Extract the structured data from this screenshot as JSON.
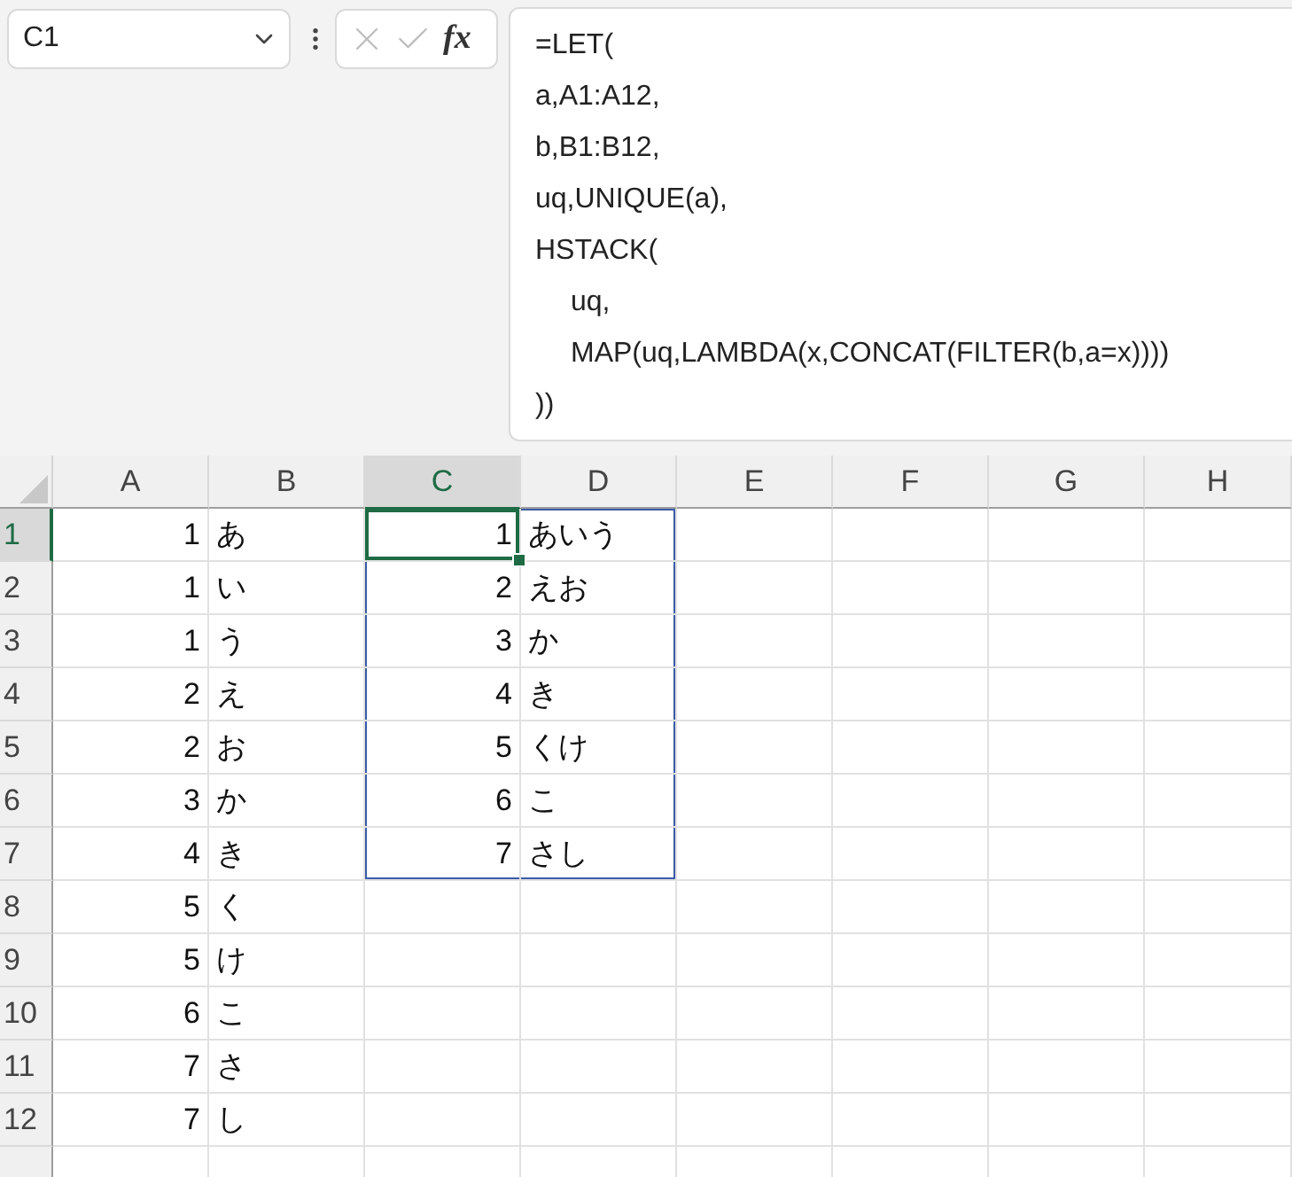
{
  "name_box": {
    "value": "C1"
  },
  "formula_bar": {
    "cancel_enabled": false,
    "enter_enabled": false,
    "function_label": "fx",
    "lines": [
      {
        "text": "=LET("
      },
      {
        "text": "a,A1:A12,"
      },
      {
        "text": "b,B1:B12,"
      },
      {
        "text": "uq,UNIQUE(a),"
      },
      {
        "text": "HSTACK(",
        "children": [
          {
            "text": "uq,"
          },
          {
            "text": "MAP(uq,LAMBDA(x,CONCAT(FILTER(b,a=x))))"
          }
        ]
      },
      {
        "text": "))"
      }
    ]
  },
  "columns": [
    {
      "label": "A",
      "selected": false
    },
    {
      "label": "B",
      "selected": false
    },
    {
      "label": "C",
      "selected": true
    },
    {
      "label": "D",
      "selected": false
    },
    {
      "label": "E",
      "selected": false
    },
    {
      "label": "F",
      "selected": false
    },
    {
      "label": "G",
      "selected": false
    },
    {
      "label": "H",
      "selected": false
    }
  ],
  "rows": [
    {
      "label": "1",
      "selected": true,
      "cells": [
        {
          "text": "1"
        },
        {
          "text": "あ"
        },
        {
          "text": "1",
          "spill": true
        },
        {
          "text": "あいう",
          "spill": true
        },
        {},
        {},
        {},
        {}
      ]
    },
    {
      "label": "2",
      "selected": false,
      "cells": [
        {
          "text": "1"
        },
        {
          "text": "い"
        },
        {
          "text": "2",
          "spill": true
        },
        {
          "text": "えお",
          "spill": true
        },
        {},
        {},
        {},
        {}
      ]
    },
    {
      "label": "3",
      "selected": false,
      "cells": [
        {
          "text": "1"
        },
        {
          "text": "う"
        },
        {
          "text": "3",
          "spill": true
        },
        {
          "text": "か",
          "spill": true
        },
        {},
        {},
        {},
        {}
      ]
    },
    {
      "label": "4",
      "selected": false,
      "cells": [
        {
          "text": "2"
        },
        {
          "text": "え"
        },
        {
          "text": "4",
          "spill": true
        },
        {
          "text": "き",
          "spill": true
        },
        {},
        {},
        {},
        {}
      ]
    },
    {
      "label": "5",
      "selected": false,
      "cells": [
        {
          "text": "2"
        },
        {
          "text": "お"
        },
        {
          "text": "5",
          "spill": true
        },
        {
          "text": "くけ",
          "spill": true
        },
        {},
        {},
        {},
        {}
      ]
    },
    {
      "label": "6",
      "selected": false,
      "cells": [
        {
          "text": "3"
        },
        {
          "text": "か"
        },
        {
          "text": "6",
          "spill": true
        },
        {
          "text": "こ",
          "spill": true
        },
        {},
        {},
        {},
        {}
      ]
    },
    {
      "label": "7",
      "selected": false,
      "cells": [
        {
          "text": "4"
        },
        {
          "text": "き"
        },
        {
          "text": "7",
          "spill": true
        },
        {
          "text": "さし",
          "spill": true
        },
        {},
        {},
        {},
        {}
      ]
    },
    {
      "label": "8",
      "selected": false,
      "cells": [
        {
          "text": "5"
        },
        {
          "text": "く"
        },
        {},
        {},
        {},
        {},
        {},
        {}
      ]
    },
    {
      "label": "9",
      "selected": false,
      "cells": [
        {
          "text": "5"
        },
        {
          "text": "け"
        },
        {},
        {},
        {},
        {},
        {},
        {}
      ]
    },
    {
      "label": "10",
      "selected": false,
      "cells": [
        {
          "text": "6"
        },
        {
          "text": "こ"
        },
        {},
        {},
        {},
        {},
        {},
        {}
      ]
    },
    {
      "label": "11",
      "selected": false,
      "cells": [
        {
          "text": "7"
        },
        {
          "text": "さ"
        },
        {},
        {},
        {},
        {},
        {},
        {}
      ]
    },
    {
      "label": "12",
      "selected": false,
      "cells": [
        {
          "text": "7"
        },
        {
          "text": "し"
        },
        {},
        {},
        {},
        {},
        {},
        {}
      ]
    }
  ]
}
